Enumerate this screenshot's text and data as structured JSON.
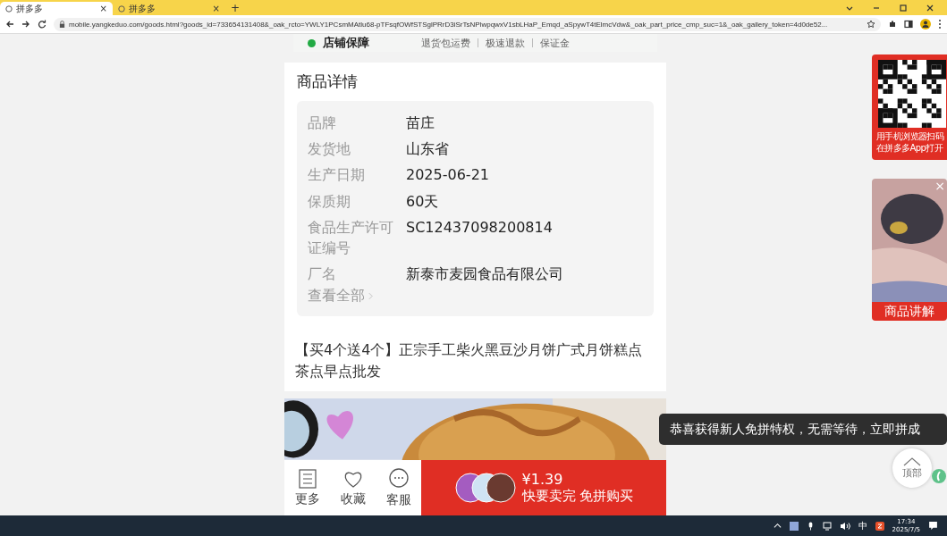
{
  "browser": {
    "tabs": [
      {
        "title": "拼多多",
        "selected": true,
        "close": "×"
      },
      {
        "title": "拼多多",
        "selected": false,
        "close": "×"
      }
    ],
    "new_tab": "+",
    "url": "mobile.yangkeduo.com/goods.html?goods_id=733654131408&_oak_rcto=YWLY1PCsmMAtlu68-pTFsqfOWfSTSglPRrD3iSrTsNPlwpqwxV1sbLHaP_Emqd_aSpywT4tElmcVdw&_oak_part_price_cmp_suc=1&_oak_gallery_token=4d0de52..."
  },
  "guarantee": {
    "title": "店铺保障",
    "items": [
      "退货包运费",
      "极速退款",
      "保证金"
    ]
  },
  "details": {
    "title": "商品详情",
    "rows": [
      {
        "label": "品牌",
        "value": "苗庄"
      },
      {
        "label": "发货地",
        "value": "山东省"
      },
      {
        "label": "生产日期",
        "value": "2025-06-21"
      },
      {
        "label": "保质期",
        "value": "60天"
      },
      {
        "label": "食品生产许可证编号",
        "value": "SC12437098200814"
      },
      {
        "label": "厂名",
        "value": "新泰市麦园食品有限公司"
      }
    ],
    "view_all": "查看全部"
  },
  "product_title": "【买4个送4个】正宗手工柴火黑豆沙月饼广式月饼糕点茶点早点批发",
  "bottom_bar": {
    "actions": [
      {
        "label": "更多",
        "kind": "menu"
      },
      {
        "label": "收藏",
        "kind": "heart"
      },
      {
        "label": "客服",
        "kind": "chat"
      }
    ],
    "price": "¥1.39",
    "buy_label": "快要卖完 免拼购买"
  },
  "qr_card": {
    "lines": [
      "用手机浏览器扫码",
      "在拼多多App打开"
    ]
  },
  "video_card": {
    "label": "商品讲解",
    "close": "×"
  },
  "toast": "恭喜获得新人免拼特权，无需等待，立即拼成",
  "top_button": "顶部",
  "taskbar": {
    "ime": "中",
    "time": "17:34",
    "date": "2025/7/5"
  }
}
